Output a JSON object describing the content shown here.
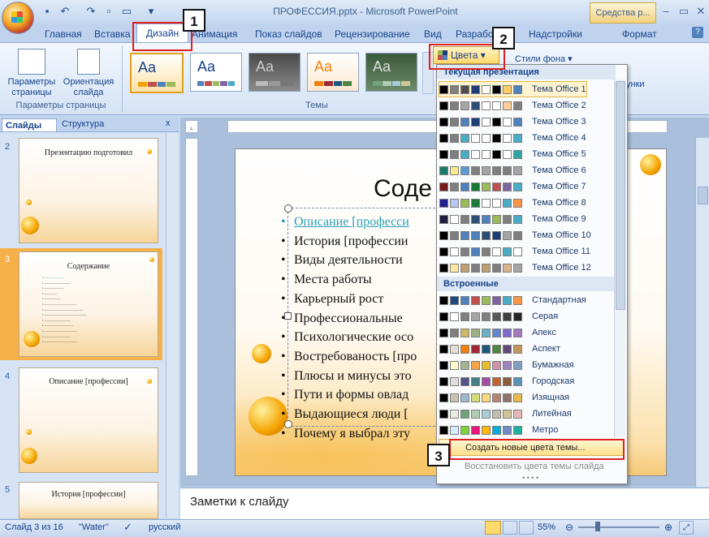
{
  "window": {
    "title": "ПРОФЕССИЯ.pptx - Microsoft PowerPoint",
    "tools_tab": "Средства р..."
  },
  "tabs": [
    "Главная",
    "Вставка",
    "Дизайн",
    "Анимация",
    "Показ слайдов",
    "Рецензирование",
    "Вид",
    "Разрабо",
    "Надстройки",
    "Формат"
  ],
  "ribbon": {
    "page_setup": {
      "params_label_1": "Параметры",
      "params_label_2": "страницы",
      "orient_label_1": "Ориентация",
      "orient_label_2": "слайда",
      "group_label": "Параметры страницы"
    },
    "themes_group_label": "Темы",
    "theme_thumb_text": "Aa",
    "colors_button": "Цвета",
    "bg_styles": "Стили фона",
    "right_partial": "унки"
  },
  "panes": {
    "slides_tab": "Слайды",
    "outline_tab": "Структура",
    "close": "x"
  },
  "thumbnails": [
    {
      "num": "2",
      "title": "Презентацию подготовил"
    },
    {
      "num": "3",
      "title": "Содержание"
    },
    {
      "num": "4",
      "title": "Описание [профессии]"
    },
    {
      "num": "5",
      "title": "История [профессии]"
    }
  ],
  "slide": {
    "title": "Соде",
    "bullets": [
      "Описание [професси",
      "История [профессии",
      "Виды деятельности",
      "Места работы",
      "Карьерный рост",
      "Профессиональные",
      "Психологические осо",
      "Востребованость [про",
      "Плюсы и минусы это",
      "Пути и формы овлад",
      "Выдающиеся люди [",
      "Почему я выбрал эту"
    ]
  },
  "notes": "Заметки к слайду",
  "status": {
    "slide": "Слайд 3 из 16",
    "theme": "\"Water\"",
    "lang": "русский",
    "zoom": "55%"
  },
  "dropdown": {
    "current_header": "Текущая презентация",
    "builtin_header": "Встроенные",
    "current": [
      {
        "name": "Тема Office 1",
        "colors": [
          "#000000",
          "#7f7f7f",
          "#4f4f4f",
          "#1f3d7a",
          "#ffffff",
          "#000000",
          "#ffcc66",
          "#4f81bd"
        ]
      },
      {
        "name": "Тема Office 2",
        "colors": [
          "#000000",
          "#7f7f7f",
          "#a5a5a5",
          "#2c4d75",
          "#ffffff",
          "#ffffff",
          "#ffcc99",
          "#7f7f7f"
        ]
      },
      {
        "name": "Тема Office 3",
        "colors": [
          "#000000",
          "#7f7f7f",
          "#4f81bd",
          "#1f3d7a",
          "#ffffff",
          "#000000",
          "#ffffff",
          "#4f81bd"
        ]
      },
      {
        "name": "Тема Office 4",
        "colors": [
          "#000000",
          "#7f7f7f",
          "#4bacc6",
          "#ffffff",
          "#ffffff",
          "#000000",
          "#ffffff",
          "#4bacc6"
        ]
      },
      {
        "name": "Тема Office 5",
        "colors": [
          "#000000",
          "#7f7f7f",
          "#4bacc6",
          "#ffffff",
          "#ffffff",
          "#000000",
          "#ffffff",
          "#2fa4a4"
        ]
      },
      {
        "name": "Тема Office 6",
        "colors": [
          "#1b7a6b",
          "#f5e88c",
          "#5b9bd5",
          "#7f7f7f",
          "#a5a5a5",
          "#7f7f7f",
          "#7f7f7f",
          "#a5a5a5"
        ]
      },
      {
        "name": "Тема Office 7",
        "colors": [
          "#7a1b1b",
          "#7f7f7f",
          "#4f81bd",
          "#1b7a3a",
          "#9bbb59",
          "#c0504d",
          "#8064a2",
          "#4bacc6"
        ]
      },
      {
        "name": "Тема Office 8",
        "colors": [
          "#1f1f8f",
          "#b8c8f0",
          "#9bbb59",
          "#1b7a3a",
          "#ffffff",
          "#ffffff",
          "#4bacc6",
          "#f79646"
        ]
      },
      {
        "name": "Тема Office 9",
        "colors": [
          "#1f1f3f",
          "#ffffff",
          "#7f7f7f",
          "#2c4d75",
          "#4f81bd",
          "#9bbb59",
          "#7f7f7f",
          "#4bacc6"
        ]
      },
      {
        "name": "Тема Office 10",
        "colors": [
          "#000000",
          "#7f7f7f",
          "#4f81bd",
          "#4f81bd",
          "#2c4d75",
          "#1f3d7a",
          "#a5a5a5",
          "#7f7f7f"
        ]
      },
      {
        "name": "Тема Office 11",
        "colors": [
          "#000000",
          "#ffffff",
          "#7f7f7f",
          "#4f81bd",
          "#7f7f7f",
          "#ffffff",
          "#4bacc6",
          "#ffffff"
        ]
      },
      {
        "name": "Тема Office 12",
        "colors": [
          "#000000",
          "#ffe8a0",
          "#c0a070",
          "#7f7f7f",
          "#c0a070",
          "#7f7f7f",
          "#d9b38c",
          "#a5a5a5"
        ]
      }
    ],
    "builtin": [
      {
        "name": "Стандартная",
        "colors": [
          "#000000",
          "#1f497d",
          "#4f81bd",
          "#c0504d",
          "#9bbb59",
          "#8064a2",
          "#4bacc6",
          "#f79646"
        ]
      },
      {
        "name": "Серая",
        "colors": [
          "#000000",
          "#ffffff",
          "#7f7f7f",
          "#a5a5a5",
          "#7f7f7f",
          "#595959",
          "#3f3f3f",
          "#262626"
        ]
      },
      {
        "name": "Апекс",
        "colors": [
          "#000000",
          "#7f7f7f",
          "#ceb966",
          "#9cb084",
          "#6bb1c9",
          "#6585cf",
          "#7e6bc9",
          "#a379bb"
        ]
      },
      {
        "name": "Аспект",
        "colors": [
          "#000000",
          "#e3ded1",
          "#f07f09",
          "#9f2936",
          "#1b587c",
          "#4e8542",
          "#604878",
          "#c19859"
        ]
      },
      {
        "name": "Бумажная",
        "colors": [
          "#000000",
          "#fefac9",
          "#a5b592",
          "#f3a447",
          "#e7bc29",
          "#d092a7",
          "#9c85c0",
          "#809ec2"
        ]
      },
      {
        "name": "Городская",
        "colors": [
          "#000000",
          "#dedede",
          "#53548a",
          "#438086",
          "#a04da3",
          "#c4652d",
          "#8b5d3d",
          "#5c92b5"
        ]
      },
      {
        "name": "Изящная",
        "colors": [
          "#000000",
          "#c6c1b1",
          "#9fb8cd",
          "#d2da7a",
          "#fada7a",
          "#b88472",
          "#8e736a",
          "#e7bb4b"
        ]
      },
      {
        "name": "Литейная",
        "colors": [
          "#000000",
          "#eaebde",
          "#72a376",
          "#b0ccb0",
          "#a8cdd7",
          "#c0beaf",
          "#cec597",
          "#e8b7b7"
        ]
      },
      {
        "name": "Метро",
        "colors": [
          "#000000",
          "#d6ecff",
          "#7fd13b",
          "#ea157a",
          "#feb80a",
          "#00addc",
          "#738ac8",
          "#1ab39f"
        ]
      }
    ],
    "create_new": "Создать новые цвета темы...",
    "restore": "Восстановить цвета темы слайда"
  },
  "callouts": [
    "1",
    "2",
    "3"
  ]
}
